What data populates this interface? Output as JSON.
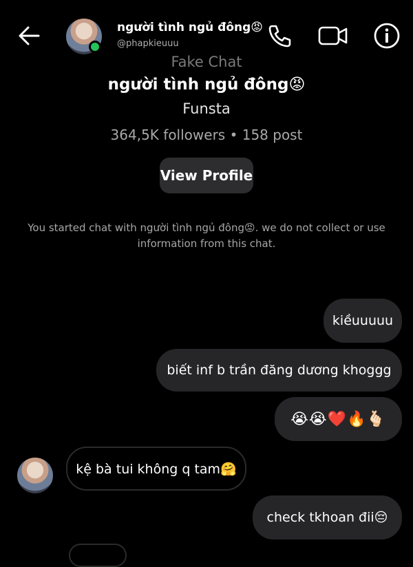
{
  "header": {
    "name": "người tình ngủ đông😡",
    "username": "@phapkieuuu"
  },
  "profile": {
    "tag": "Fake Chat",
    "name": "người tình ngủ đông😡",
    "category": "Funsta",
    "stats": "364,5K followers • 158 post",
    "view_profile_label": "View Profile"
  },
  "notice": "You started chat with người tình ngủ đông😡. we do not collect or use information from this chat.",
  "messages": [
    {
      "from": "me",
      "text": "kiềuuuuu"
    },
    {
      "from": "me",
      "text": "biết inf b trần đăng dương khoggg"
    },
    {
      "from": "me",
      "text": "😭😭❤️🔥🫰🏻"
    },
    {
      "from": "them",
      "text": "kệ bà tui không q tam🤗"
    },
    {
      "from": "me",
      "text": "check tkhoan đii😔"
    }
  ],
  "colors": {
    "background": "#000000",
    "bubble": "#262628",
    "online": "#25c35c",
    "muted_text": "#a7a7a7"
  },
  "icons": [
    "back-arrow-icon",
    "phone-icon",
    "video-call-icon",
    "info-icon"
  ]
}
